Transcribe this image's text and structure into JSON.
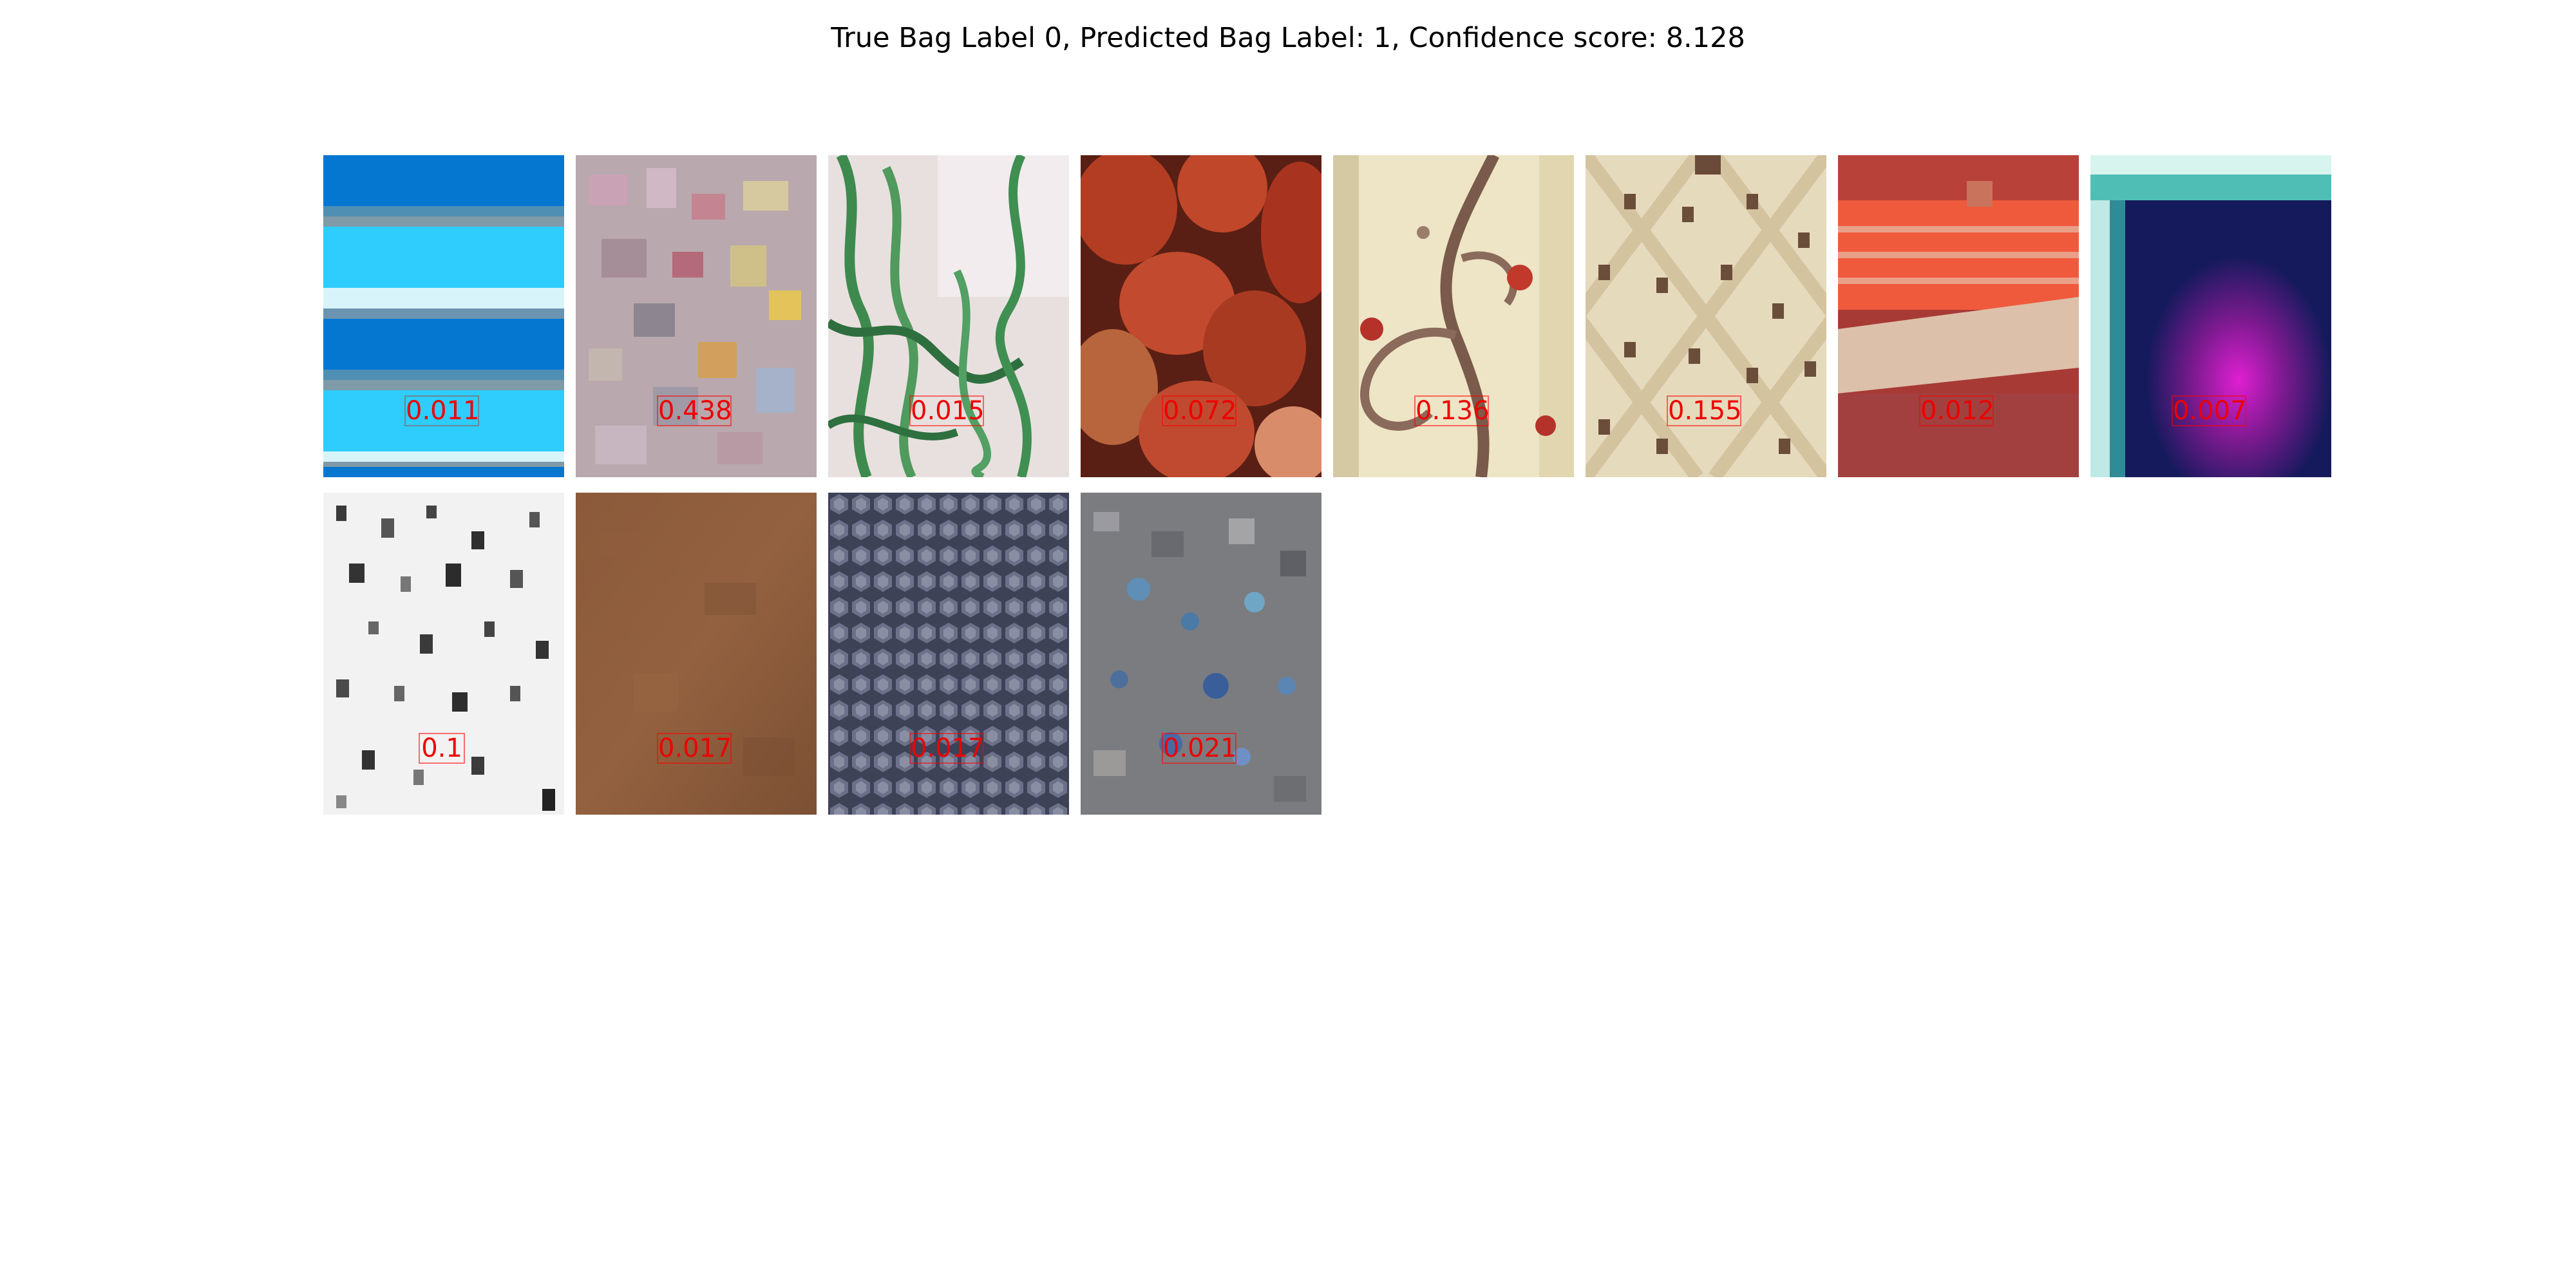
{
  "title": "True Bag Label 0, Predicted Bag Label: 1, Confidence score: 8.128",
  "instances": [
    {
      "score": "0.011",
      "texture": "blue-stripes",
      "main_color": "#0577d1"
    },
    {
      "score": "0.438",
      "texture": "colorful-flowers",
      "main_color": "#b9a8ad"
    },
    {
      "score": "0.015",
      "texture": "green-vines",
      "main_color": "#e8e0de"
    },
    {
      "score": "0.072",
      "texture": "red-fruits",
      "main_color": "#b33d22"
    },
    {
      "score": "0.136",
      "texture": "swirl-ornament",
      "main_color": "#eee4c6"
    },
    {
      "score": "0.155",
      "texture": "beige-lattice",
      "main_color": "#e6dabd"
    },
    {
      "score": "0.012",
      "texture": "red-orange-stripes",
      "main_color": "#e0422e"
    },
    {
      "score": "0.007",
      "texture": "dark-magenta-glow",
      "main_color": "#151a5c"
    },
    {
      "score": "0.1",
      "texture": "black-white-dots",
      "main_color": "#f2f2f2"
    },
    {
      "score": "0.017",
      "texture": "brown-leather",
      "main_color": "#8e5c3c"
    },
    {
      "score": "0.017",
      "texture": "grey-honeycomb",
      "main_color": "#565b70"
    },
    {
      "score": "0.021",
      "texture": "grey-blue-speckle",
      "main_color": "#7b7c80"
    }
  ]
}
